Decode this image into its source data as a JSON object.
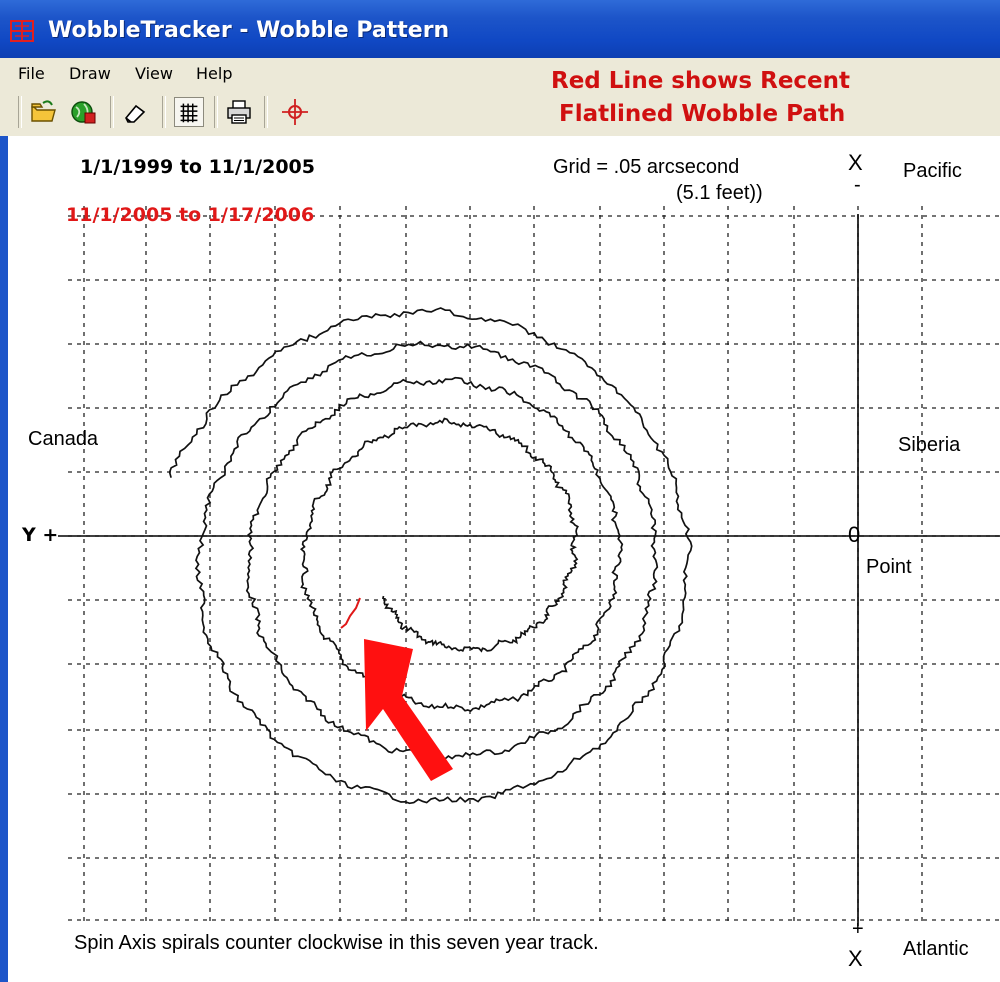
{
  "window": {
    "title": "WobbleTracker - Wobble Pattern",
    "title_icon": "grid-target-icon"
  },
  "menu": {
    "items": [
      {
        "label": "File"
      },
      {
        "label": "Draw"
      },
      {
        "label": "View"
      },
      {
        "label": "Help"
      }
    ]
  },
  "toolbar": {
    "buttons": [
      {
        "icon": "open-folder-icon"
      },
      {
        "icon": "globe-save-icon"
      },
      {
        "icon": "eraser-icon"
      },
      {
        "icon": "grid-icon",
        "pressed": true
      },
      {
        "icon": "printer-icon"
      },
      {
        "icon": "crosshair-icon"
      }
    ]
  },
  "annotation": {
    "line1": "Red Line shows Recent",
    "line2": "Flatlined Wobble Path",
    "color": "#d01010"
  },
  "plot": {
    "range_main": "1/1/1999 to 11/1/2005",
    "range_recent": "11/1/2005 to 1/17/2006",
    "recent_color": "#e01818",
    "grid_label_line1": "Grid = .05 arcsecond",
    "grid_label_line2": "(5.1 feet))",
    "x_top_symbol": "X",
    "x_top_sign": "-",
    "x_bottom_sign": "+",
    "x_bottom_symbol": "X",
    "y_axis_label": "Y +",
    "origin_symbol": "0",
    "origin_label": "Point",
    "region_top_right": "Pacific",
    "region_bottom_right": "Atlantic",
    "region_left": "Canada",
    "region_right": "Siberia",
    "caption": "Spin Axis spirals counter clockwise in this seven year track.",
    "grid_shown": true
  },
  "chart_data": {
    "type": "line",
    "grid_step_arcsec": 0.05,
    "series": [
      {
        "color": "#111111",
        "kind": "spiral-track"
      },
      {
        "color": "#e01818",
        "kind": "recent-track"
      }
    ]
  }
}
